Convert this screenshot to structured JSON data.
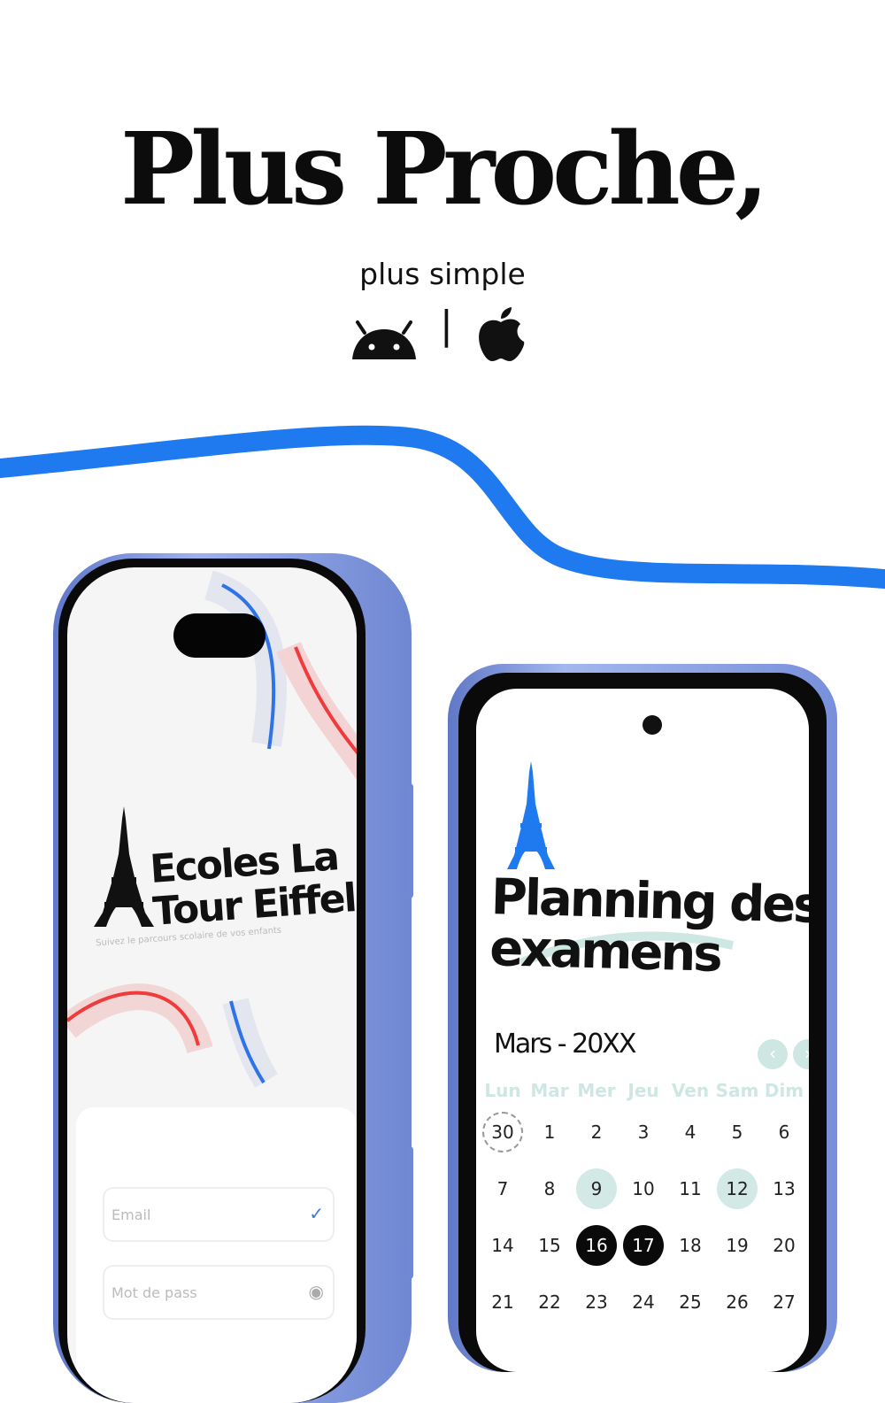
{
  "hero": {
    "title": "Plus Proche,",
    "subtitle": "plus simple",
    "platform_icons": [
      "android-icon",
      "apple-icon"
    ],
    "separator": "|"
  },
  "colors": {
    "wave": "#1f7aef",
    "phone_frame": "#8aa0e6",
    "accent_red": "#ef3b3b",
    "accent_blue": "#2f73e8",
    "exam_day": "#d3e9e6",
    "selected_day": "#0a0a0a"
  },
  "login_screen": {
    "brand_line1": "Ecoles La",
    "brand_line2": "Tour Eiffel",
    "tagline": "Suivez le parcours scolaire de vos enfants",
    "email_placeholder": "Email",
    "password_placeholder": "Mot de pass"
  },
  "planning_screen": {
    "title_line1": "Planning des",
    "title_line2": "examens",
    "month": "Mars - 20XX",
    "weekdays": [
      "Lun",
      "Mar",
      "Mer",
      "Jeu",
      "Ven",
      "Sam",
      "Dim"
    ],
    "weeks": [
      [
        "30",
        "1",
        "2",
        "3",
        "4",
        "5",
        "6"
      ],
      [
        "7",
        "8",
        "9",
        "10",
        "11",
        "12",
        "13"
      ],
      [
        "14",
        "15",
        "16",
        "17",
        "18",
        "19",
        "20"
      ],
      [
        "21",
        "22",
        "23",
        "24",
        "25",
        "26",
        "27"
      ]
    ],
    "exam_days": [
      "9",
      "12"
    ],
    "selected_days": [
      "16",
      "17"
    ],
    "today": "30"
  }
}
